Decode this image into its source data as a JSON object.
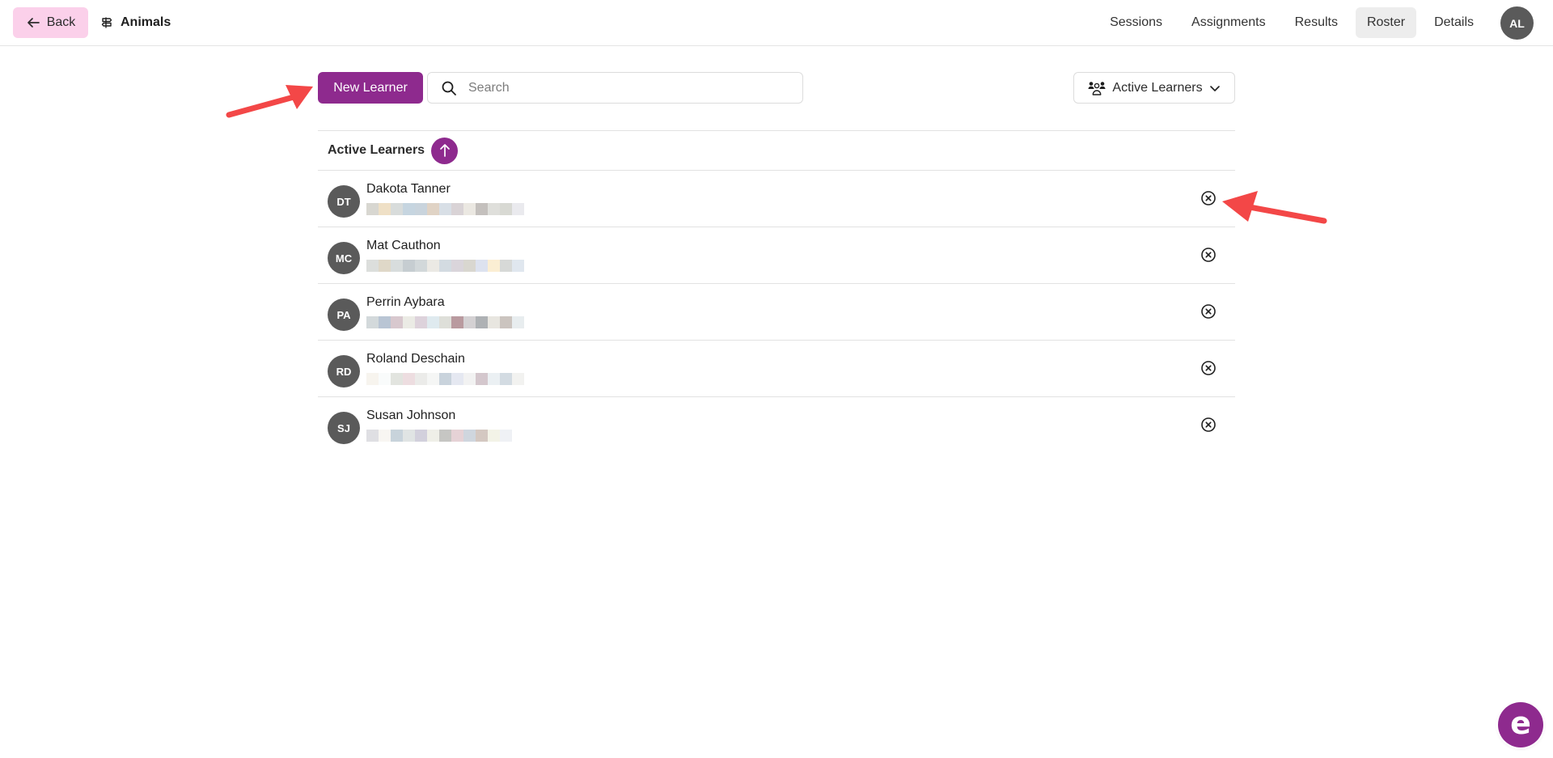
{
  "header": {
    "back_label": "Back",
    "back_icon": "arrow-left-icon",
    "breadcrumb_icon": "signpost-icon",
    "breadcrumb_title": "Animals",
    "tabs": [
      {
        "label": "Sessions",
        "active": false
      },
      {
        "label": "Assignments",
        "active": false
      },
      {
        "label": "Results",
        "active": false
      },
      {
        "label": "Roster",
        "active": true
      },
      {
        "label": "Details",
        "active": false
      }
    ],
    "user_initials": "AL"
  },
  "toolbar": {
    "new_button_label": "New Learner",
    "search_placeholder": "Search",
    "search_value": "",
    "filter_label": "Active Learners",
    "filter_icon": "users-icon"
  },
  "list": {
    "section_label": "Active Learners",
    "sort_direction": "ascending",
    "learners": [
      {
        "initials": "DT",
        "name": "Dakota Tanner",
        "email": "[redacted]",
        "blur": [
          "#d8d7d1",
          "#efe0c6",
          "#d8dcdb",
          "#c6d5e0",
          "#c9d4dd",
          "#e0d3c5",
          "#d8dfe6",
          "#d9d3d6",
          "#ebe8e2",
          "#c4c0bd",
          "#dfdfdb",
          "#d8d9d3",
          "#eaeaee"
        ]
      },
      {
        "initials": "MC",
        "name": "Mat Cauthon",
        "email": "[redacted]",
        "blur": [
          "#dcdedc",
          "#dfd8c8",
          "#d8dddd",
          "#c6cdd1",
          "#d2d8da",
          "#ebe9e4",
          "#d3dbe1",
          "#dad5db",
          "#d9d7d0",
          "#dde2ef",
          "#fbeed3",
          "#d7d9d7",
          "#e0e7ef"
        ]
      },
      {
        "initials": "PA",
        "name": "Perrin Aybara",
        "email": "[redacted]",
        "blur": [
          "#d3d9db",
          "#b9c5d4",
          "#d8c8ce",
          "#ebebe5",
          "#ddd2db",
          "#dfeaef",
          "#dedfd9",
          "#b99a9f",
          "#d4d1d3",
          "#aeb1b4",
          "#e8e6e0",
          "#cbc4bf",
          "#e8edef"
        ]
      },
      {
        "initials": "RD",
        "name": "Roland Deschain",
        "email": "[redacted]",
        "blur": [
          "#f7f4ee",
          "#f9fbfb",
          "#e2e4df",
          "#eddde0",
          "#ebebe9",
          "#f5f6f5",
          "#c9d3dc",
          "#e5e8f1",
          "#f2f2f2",
          "#d4c7cd",
          "#ebf0f3",
          "#d3dbe2",
          "#f2f2f0"
        ]
      },
      {
        "initials": "SJ",
        "name": "Susan Johnson",
        "email": "[redacted]",
        "blur": [
          "#dfdfe3",
          "#f8f6f2",
          "#c8d3db",
          "#e0e4e4",
          "#d2d0dc",
          "#efefe8",
          "#c6c6c3",
          "#e6d2d6",
          "#cfd6de",
          "#d4c8c1",
          "#f3f3e7",
          "#eff1f5"
        ]
      }
    ]
  },
  "annotations": {
    "color": "#f34747",
    "arrows": [
      "pointing-to-new-learner-button",
      "pointing-to-first-remove-button"
    ]
  },
  "chat_widget": {
    "glyph": "e",
    "brand_color": "#8e2a8e"
  }
}
